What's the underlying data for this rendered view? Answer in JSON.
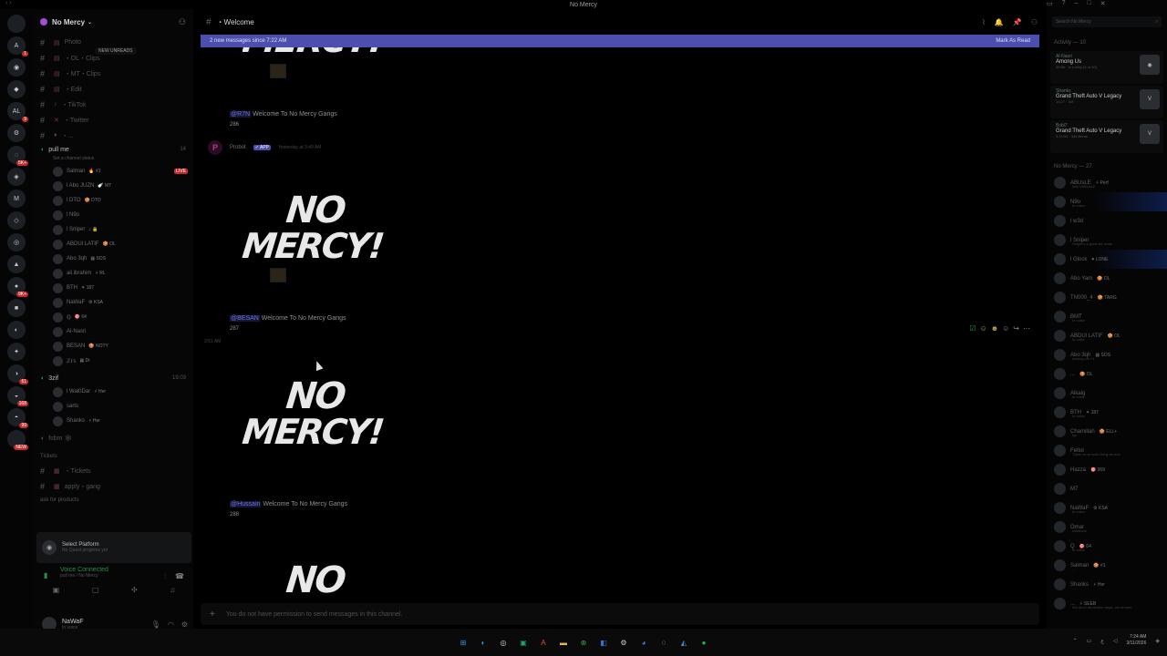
{
  "window": {
    "title": "No Mercy"
  },
  "server": {
    "name": "No Mercy"
  },
  "rail": {
    "servers": [
      {
        "icon": "discord-icon",
        "label": "",
        "badge": ""
      },
      {
        "icon": "server",
        "label": "A",
        "badge": "1"
      },
      {
        "icon": "server",
        "label": "◉",
        "badge": ""
      },
      {
        "icon": "server",
        "label": "◆",
        "badge": ""
      },
      {
        "icon": "server",
        "label": "AL",
        "badge": "9"
      },
      {
        "icon": "server",
        "label": "⚙",
        "badge": ""
      },
      {
        "icon": "server",
        "label": "◌",
        "badge": "5K+"
      },
      {
        "icon": "server",
        "label": "◈",
        "badge": ""
      },
      {
        "icon": "server",
        "label": "M",
        "badge": ""
      },
      {
        "icon": "server",
        "label": "◇",
        "badge": ""
      },
      {
        "icon": "server",
        "label": "◎",
        "badge": ""
      },
      {
        "icon": "server",
        "label": "▲",
        "badge": ""
      },
      {
        "icon": "server",
        "label": "●",
        "badge": "9K+"
      },
      {
        "icon": "server",
        "label": "■",
        "badge": ""
      },
      {
        "icon": "server",
        "label": "◐",
        "badge": ""
      },
      {
        "icon": "server",
        "label": "✦",
        "badge": ""
      },
      {
        "icon": "server",
        "label": "◑",
        "badge": "61"
      },
      {
        "icon": "server",
        "label": "◒",
        "badge": "168"
      },
      {
        "icon": "server",
        "label": "◓",
        "badge": "99"
      },
      {
        "icon": "server",
        "label": "",
        "badge": "NEW"
      }
    ]
  },
  "sidebar": {
    "new_unreads": "NEW UNREADS",
    "channels": [
      {
        "emoji": "▤",
        "name": "Photo"
      },
      {
        "emoji": "▤",
        "name": "・OL・Clips"
      },
      {
        "emoji": "▤",
        "name": "・MT・Clips"
      },
      {
        "emoji": "▤",
        "name": "・Edit"
      },
      {
        "emoji": "♪",
        "name": "・TikTok"
      },
      {
        "emoji": "✕",
        "name": "・Twitter"
      },
      {
        "emoji": "♦",
        "name": "・..."
      }
    ],
    "voice_channel": {
      "name": "pull me",
      "count": "14",
      "status": "Set a channel status"
    },
    "voice_members": [
      {
        "name": "Salman",
        "tag": "🔥 #1",
        "flag": "LIVE"
      },
      {
        "name": "l Abo JUZN",
        "tag": "🍼 MT",
        "flag": ""
      },
      {
        "name": "l DTO",
        "tag": "🍪 DTO",
        "flag": ""
      },
      {
        "name": "l N9o",
        "tag": "",
        "flag": ""
      },
      {
        "name": "l Sniper",
        "tag": "♪ 🔒",
        "flag": ""
      },
      {
        "name": "ABDUl LATIF",
        "tag": "🍪 OL",
        "flag": ""
      },
      {
        "name": "Abo 3qh",
        "tag": "▦ SOS",
        "flag": ""
      },
      {
        "name": "ali ibrahim",
        "tag": "⚡ RL",
        "flag": ""
      },
      {
        "name": "BTH",
        "tag": "✦ 187",
        "flag": ""
      },
      {
        "name": "NaWaF",
        "tag": "⚙ KSA",
        "flag": ""
      },
      {
        "name": "ℚ",
        "tag": "🎯 64",
        "flag": ""
      },
      {
        "name": "Al-Nasri",
        "tag": "",
        "flag": ""
      },
      {
        "name": "BESAN",
        "tag": "🍪 NOTY",
        "flag": ""
      },
      {
        "name": "ℤ𝕣𝕤",
        "tag": "▦ Dr",
        "flag": ""
      }
    ],
    "voice_channel_2": {
      "name": "3zif",
      "count": "19:03"
    },
    "voice_members_2": [
      {
        "name": "l Wal0Dar",
        "tag": "⚡ Her"
      },
      {
        "name": "sarts",
        "tag": ""
      },
      {
        "name": "Shanks",
        "tag": "⚡ Her"
      }
    ],
    "extra_channel": "fsbm 🕸",
    "category_tickets": "Tickets",
    "tickets_channels": [
      {
        "emoji": "▦",
        "name": "・Tickets"
      },
      {
        "emoji": "▦",
        "name": "apply・gang"
      }
    ],
    "category_ask": "ask for products"
  },
  "platform_panel": {
    "title": "Select Platform",
    "subtitle": "No Quest progress yet"
  },
  "voice_panel": {
    "title": "Voice Connected",
    "subtitle": "pull me / No Mercy"
  },
  "user_panel": {
    "name": "NaWaF",
    "status": "In voice"
  },
  "channel": {
    "name": "・Welcome"
  },
  "banner": {
    "text": "2 new messages since 7:22 AM",
    "action": "Mark As Read"
  },
  "messages": [
    {
      "mention": "@R7N",
      "text": "Welcome To No Mercy Gangs",
      "count": "286"
    },
    {
      "mention": "@BESAN",
      "text": "Welcome To No Mercy Gangs",
      "count": "287"
    },
    {
      "mention": "@Hussain",
      "text": "Welcome To No Mercy Gangs",
      "count": "288"
    }
  ],
  "bot": {
    "name": "Probot",
    "tag": "✓ APP",
    "time": "Yesterday at 3:49 AM"
  },
  "logo": {
    "line1": "NO",
    "line2": "MERCY!"
  },
  "time_separator": "3:51 AM",
  "composer": {
    "placeholder": "You do not have permission to send messages in this channel."
  },
  "search": {
    "placeholder": "Search No Mercy"
  },
  "activity": {
    "header": "Activity — 10",
    "cards": [
      {
        "user": "Al-Nasri",
        "game": "Among Us",
        "detail": "45:56 · In Lobby (4 of 10)"
      },
      {
        "user": "Shanks",
        "game": "Grand Theft Auto V Legacy",
        "detail": "14:27 · 3of"
      },
      {
        "user": "Bsbl7",
        "game": "Grand Theft Auto V Legacy",
        "detail": "3:23:54 · 33s Break"
      }
    ]
  },
  "members_header": "No Mercy — 27",
  "members": [
    {
      "name": "ABUsLE",
      "tag": "⚡ Perf",
      "status": "linkl VABUsLE"
    },
    {
      "name": "N9o",
      "tag": "",
      "status": "In voice"
    },
    {
      "name": "l w3d",
      "tag": "",
      "status": ""
    },
    {
      "name": "l Sniper",
      "tag": "",
      "status": "Sniper's a good ish mate"
    },
    {
      "name": "l Glock",
      "tag": "♥ LONE",
      "status": ""
    },
    {
      "name": "Abo Yam",
      "tag": "🍪 OL",
      "status": ""
    },
    {
      "name": "TN000_4",
      "tag": "🍪 TARG",
      "status": ""
    },
    {
      "name": "BMT",
      "tag": "",
      "status": "In voice"
    },
    {
      "name": "ABDUl LATIF",
      "tag": "🍪 OL",
      "status": "In voice"
    },
    {
      "name": "Abo 3qh",
      "tag": "▦ SOS",
      "status": "Among Us +1"
    },
    {
      "name": "...",
      "tag": "🍪 OL",
      "status": ""
    },
    {
      "name": "Alkaig",
      "tag": "",
      "status": "In voice"
    },
    {
      "name": "BTH",
      "tag": "✦ 187",
      "status": "In voice"
    },
    {
      "name": "Chamillah",
      "tag": "🍪 ELL+",
      "status": "fyk"
    },
    {
      "name": "Fetlol",
      "tag": "",
      "status": "There is no such thing as true"
    },
    {
      "name": "Hazza",
      "tag": "🎯 969",
      "status": ""
    },
    {
      "name": "M7",
      "tag": "",
      "status": ""
    },
    {
      "name": "NaWaF",
      "tag": "⚙ KSA",
      "status": "In voice"
    },
    {
      "name": "Omar",
      "tag": "",
      "status": "solutions"
    },
    {
      "name": "Q",
      "tag": "🎯 64",
      "status": "In voice"
    },
    {
      "name": "Salman",
      "tag": "🍪 #1",
      "status": "..."
    },
    {
      "name": "Shanks",
      "tag": "⚡ Her",
      "status": "..."
    },
    {
      "name": "...",
      "tag": "⚡ SEEB",
      "status": "We don't remember days, we remem"
    }
  ],
  "taskbar": {
    "time": "7:24 AM",
    "date": "3/11/2026"
  }
}
